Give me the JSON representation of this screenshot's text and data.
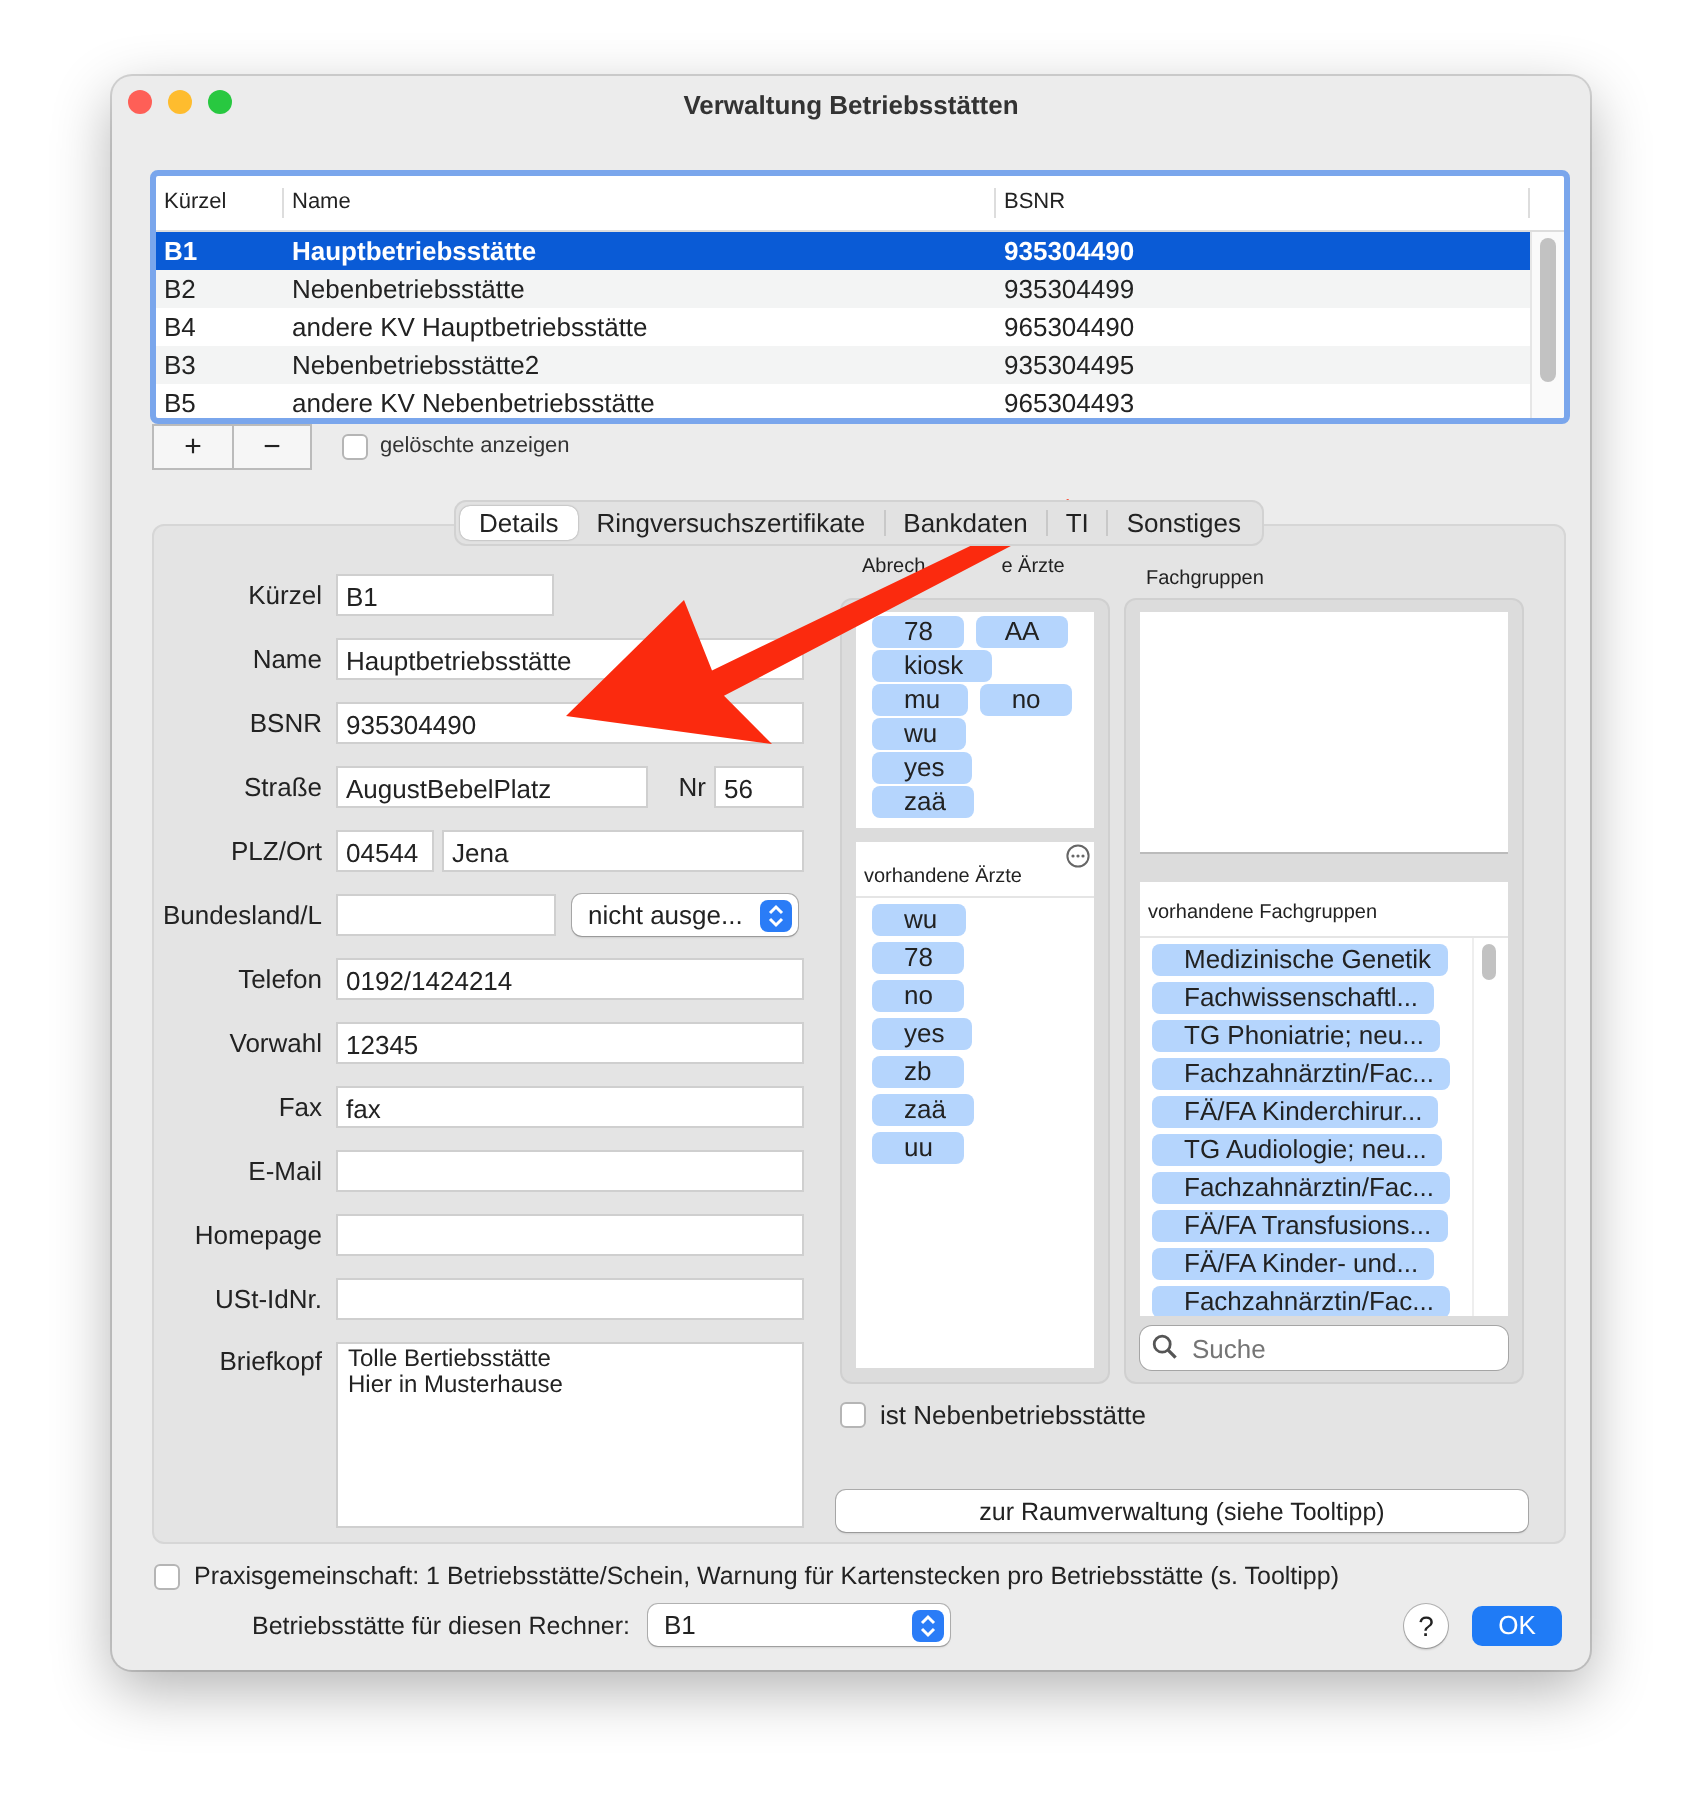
{
  "window": {
    "title": "Verwaltung Betriebsstätten"
  },
  "table": {
    "columns": [
      "Kürzel",
      "Name",
      "BSNR"
    ],
    "rows": [
      {
        "cells": [
          "B1",
          "Hauptbetriebsstätte",
          "935304490"
        ],
        "selected": true
      },
      {
        "cells": [
          "B2",
          "Nebenbetriebsstätte",
          "935304499"
        ],
        "selected": false
      },
      {
        "cells": [
          "B4",
          "andere KV Hauptbetriebsstätte",
          "965304490"
        ],
        "selected": false
      },
      {
        "cells": [
          "B3",
          "Nebenbetriebsstätte2",
          "935304495"
        ],
        "selected": false
      },
      {
        "cells": [
          "B5",
          "andere KV Nebenbetriebsstätte",
          "965304493"
        ],
        "selected": false
      }
    ]
  },
  "table_buttons": [
    "+",
    "−"
  ],
  "show_deleted": {
    "label": "gelöschte anzeigen",
    "checked": false
  },
  "tabs": [
    {
      "label": "Details",
      "selected": true
    },
    {
      "label": "Ringversuchszertifikate",
      "selected": false
    },
    {
      "label": "Bankdaten",
      "selected": false
    },
    {
      "label": "TI",
      "selected": false
    },
    {
      "label": "Sonstiges",
      "selected": false
    }
  ],
  "fields": [
    {
      "kind": "short",
      "label": "Kürzel",
      "value": "B1"
    },
    {
      "kind": "text",
      "label": "Name",
      "value": "Hauptbetriebsstätte"
    },
    {
      "kind": "text",
      "label": "BSNR",
      "value": "935304490"
    },
    {
      "kind": "street",
      "label": "Straße",
      "value": "AugustBebelPlatz",
      "extra_label": "Nr",
      "extra_value": "56"
    },
    {
      "kind": "plz",
      "label": "PLZ/Ort",
      "value": "04544",
      "extra_value": "Jena"
    },
    {
      "kind": "state",
      "label": "Bundesland/L",
      "popup": "nicht ausge..."
    },
    {
      "kind": "text",
      "label": "Telefon",
      "value": "0192/1424214"
    },
    {
      "kind": "text",
      "label": "Vorwahl",
      "value": "12345"
    },
    {
      "kind": "text",
      "label": "Fax",
      "value": "fax"
    },
    {
      "kind": "text",
      "label": "E-Mail"
    },
    {
      "kind": "text",
      "label": "Homepage"
    },
    {
      "kind": "text",
      "label": "USt-IdNr."
    },
    {
      "kind": "textarea",
      "label": "Briefkopf",
      "lines": [
        "Tolle Bertiebsstätte",
        "Hier in Musterhause"
      ]
    }
  ],
  "billing_doctors": {
    "label_parts": [
      "Abrech",
      "e Ärzte"
    ],
    "rows": [
      [
        "78",
        "AA"
      ],
      [
        "kiosk"
      ],
      [
        "mu",
        "no"
      ],
      [
        "wu"
      ],
      [
        "yes"
      ],
      [
        "zaä"
      ]
    ]
  },
  "available_doctors": {
    "header": "vorhandene Ärzte",
    "items": [
      "wu",
      "78",
      "no",
      "yes",
      "zb",
      "zaä",
      "uu"
    ]
  },
  "specialty_groups": {
    "label": "Fachgruppen"
  },
  "available_groups": {
    "header": "vorhandene Fachgruppen",
    "items": [
      "Medizinische Genetik",
      "Fachwissenschaftl...",
      "TG Phoniatrie; neu...",
      "Fachzahnärztin/Fac...",
      "FÄ/FA Kinderchirur...",
      "TG Audiologie; neu...",
      "Fachzahnärztin/Fac...",
      "FÄ/FA Transfusions...",
      "FÄ/FA Kinder- und...",
      "Fachzahnärztin/Fac..."
    ],
    "search": {
      "placeholder": "Suche"
    }
  },
  "secondary_site": {
    "label": "ist Nebenbetriebsstätte",
    "checked": false
  },
  "room_button": "zur Raumverwaltung (siehe Tooltipp)",
  "practice_community": {
    "label": "Praxisgemeinschaft: 1 Betriebsstätte/Schein, Warnung für Kartenstecken pro Betriebsstätte (s. Tooltipp)",
    "checked": false
  },
  "computer_site": {
    "label": "Betriebsstätte für diesen Rechner:",
    "value": "B1"
  },
  "help_button": "?",
  "ok_button": "OK"
}
